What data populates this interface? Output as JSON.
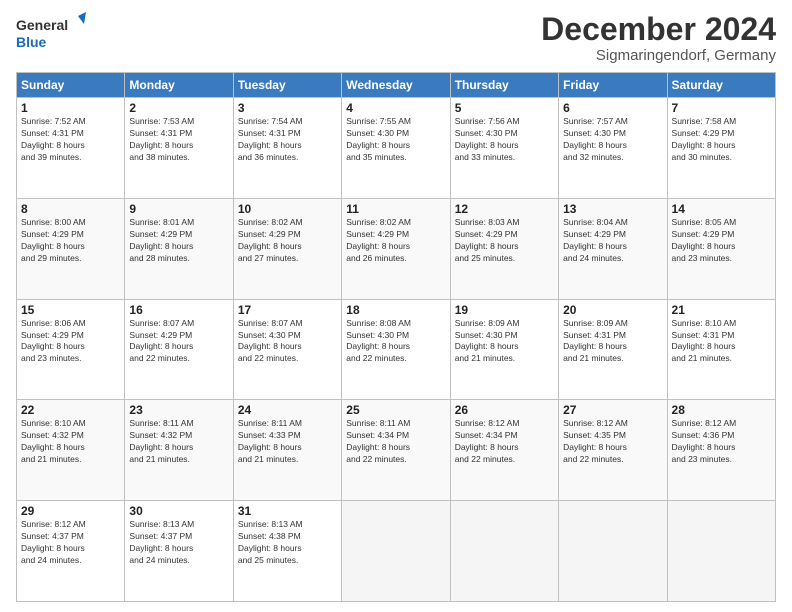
{
  "logo": {
    "line1": "General",
    "line2": "Blue"
  },
  "title": "December 2024",
  "location": "Sigmaringendorf, Germany",
  "weekdays": [
    "Sunday",
    "Monday",
    "Tuesday",
    "Wednesday",
    "Thursday",
    "Friday",
    "Saturday"
  ],
  "weeks": [
    [
      {
        "day": "1",
        "sunrise": "7:52 AM",
        "sunset": "4:31 PM",
        "daylight_hours": "8",
        "daylight_mins": "39"
      },
      {
        "day": "2",
        "sunrise": "7:53 AM",
        "sunset": "4:31 PM",
        "daylight_hours": "8",
        "daylight_mins": "38"
      },
      {
        "day": "3",
        "sunrise": "7:54 AM",
        "sunset": "4:31 PM",
        "daylight_hours": "8",
        "daylight_mins": "36"
      },
      {
        "day": "4",
        "sunrise": "7:55 AM",
        "sunset": "4:30 PM",
        "daylight_hours": "8",
        "daylight_mins": "35"
      },
      {
        "day": "5",
        "sunrise": "7:56 AM",
        "sunset": "4:30 PM",
        "daylight_hours": "8",
        "daylight_mins": "33"
      },
      {
        "day": "6",
        "sunrise": "7:57 AM",
        "sunset": "4:30 PM",
        "daylight_hours": "8",
        "daylight_mins": "32"
      },
      {
        "day": "7",
        "sunrise": "7:58 AM",
        "sunset": "4:29 PM",
        "daylight_hours": "8",
        "daylight_mins": "30"
      }
    ],
    [
      {
        "day": "8",
        "sunrise": "8:00 AM",
        "sunset": "4:29 PM",
        "daylight_hours": "8",
        "daylight_mins": "29"
      },
      {
        "day": "9",
        "sunrise": "8:01 AM",
        "sunset": "4:29 PM",
        "daylight_hours": "8",
        "daylight_mins": "28"
      },
      {
        "day": "10",
        "sunrise": "8:02 AM",
        "sunset": "4:29 PM",
        "daylight_hours": "8",
        "daylight_mins": "27"
      },
      {
        "day": "11",
        "sunrise": "8:02 AM",
        "sunset": "4:29 PM",
        "daylight_hours": "8",
        "daylight_mins": "26"
      },
      {
        "day": "12",
        "sunrise": "8:03 AM",
        "sunset": "4:29 PM",
        "daylight_hours": "8",
        "daylight_mins": "25"
      },
      {
        "day": "13",
        "sunrise": "8:04 AM",
        "sunset": "4:29 PM",
        "daylight_hours": "8",
        "daylight_mins": "24"
      },
      {
        "day": "14",
        "sunrise": "8:05 AM",
        "sunset": "4:29 PM",
        "daylight_hours": "8",
        "daylight_mins": "23"
      }
    ],
    [
      {
        "day": "15",
        "sunrise": "8:06 AM",
        "sunset": "4:29 PM",
        "daylight_hours": "8",
        "daylight_mins": "23"
      },
      {
        "day": "16",
        "sunrise": "8:07 AM",
        "sunset": "4:29 PM",
        "daylight_hours": "8",
        "daylight_mins": "22"
      },
      {
        "day": "17",
        "sunrise": "8:07 AM",
        "sunset": "4:30 PM",
        "daylight_hours": "8",
        "daylight_mins": "22"
      },
      {
        "day": "18",
        "sunrise": "8:08 AM",
        "sunset": "4:30 PM",
        "daylight_hours": "8",
        "daylight_mins": "22"
      },
      {
        "day": "19",
        "sunrise": "8:09 AM",
        "sunset": "4:30 PM",
        "daylight_hours": "8",
        "daylight_mins": "21"
      },
      {
        "day": "20",
        "sunrise": "8:09 AM",
        "sunset": "4:31 PM",
        "daylight_hours": "8",
        "daylight_mins": "21"
      },
      {
        "day": "21",
        "sunrise": "8:10 AM",
        "sunset": "4:31 PM",
        "daylight_hours": "8",
        "daylight_mins": "21"
      }
    ],
    [
      {
        "day": "22",
        "sunrise": "8:10 AM",
        "sunset": "4:32 PM",
        "daylight_hours": "8",
        "daylight_mins": "21"
      },
      {
        "day": "23",
        "sunrise": "8:11 AM",
        "sunset": "4:32 PM",
        "daylight_hours": "8",
        "daylight_mins": "21"
      },
      {
        "day": "24",
        "sunrise": "8:11 AM",
        "sunset": "4:33 PM",
        "daylight_hours": "8",
        "daylight_mins": "21"
      },
      {
        "day": "25",
        "sunrise": "8:11 AM",
        "sunset": "4:34 PM",
        "daylight_hours": "8",
        "daylight_mins": "22"
      },
      {
        "day": "26",
        "sunrise": "8:12 AM",
        "sunset": "4:34 PM",
        "daylight_hours": "8",
        "daylight_mins": "22"
      },
      {
        "day": "27",
        "sunrise": "8:12 AM",
        "sunset": "4:35 PM",
        "daylight_hours": "8",
        "daylight_mins": "22"
      },
      {
        "day": "28",
        "sunrise": "8:12 AM",
        "sunset": "4:36 PM",
        "daylight_hours": "8",
        "daylight_mins": "23"
      }
    ],
    [
      {
        "day": "29",
        "sunrise": "8:12 AM",
        "sunset": "4:37 PM",
        "daylight_hours": "8",
        "daylight_mins": "24"
      },
      {
        "day": "30",
        "sunrise": "8:13 AM",
        "sunset": "4:37 PM",
        "daylight_hours": "8",
        "daylight_mins": "24"
      },
      {
        "day": "31",
        "sunrise": "8:13 AM",
        "sunset": "4:38 PM",
        "daylight_hours": "8",
        "daylight_mins": "25"
      },
      null,
      null,
      null,
      null
    ]
  ]
}
